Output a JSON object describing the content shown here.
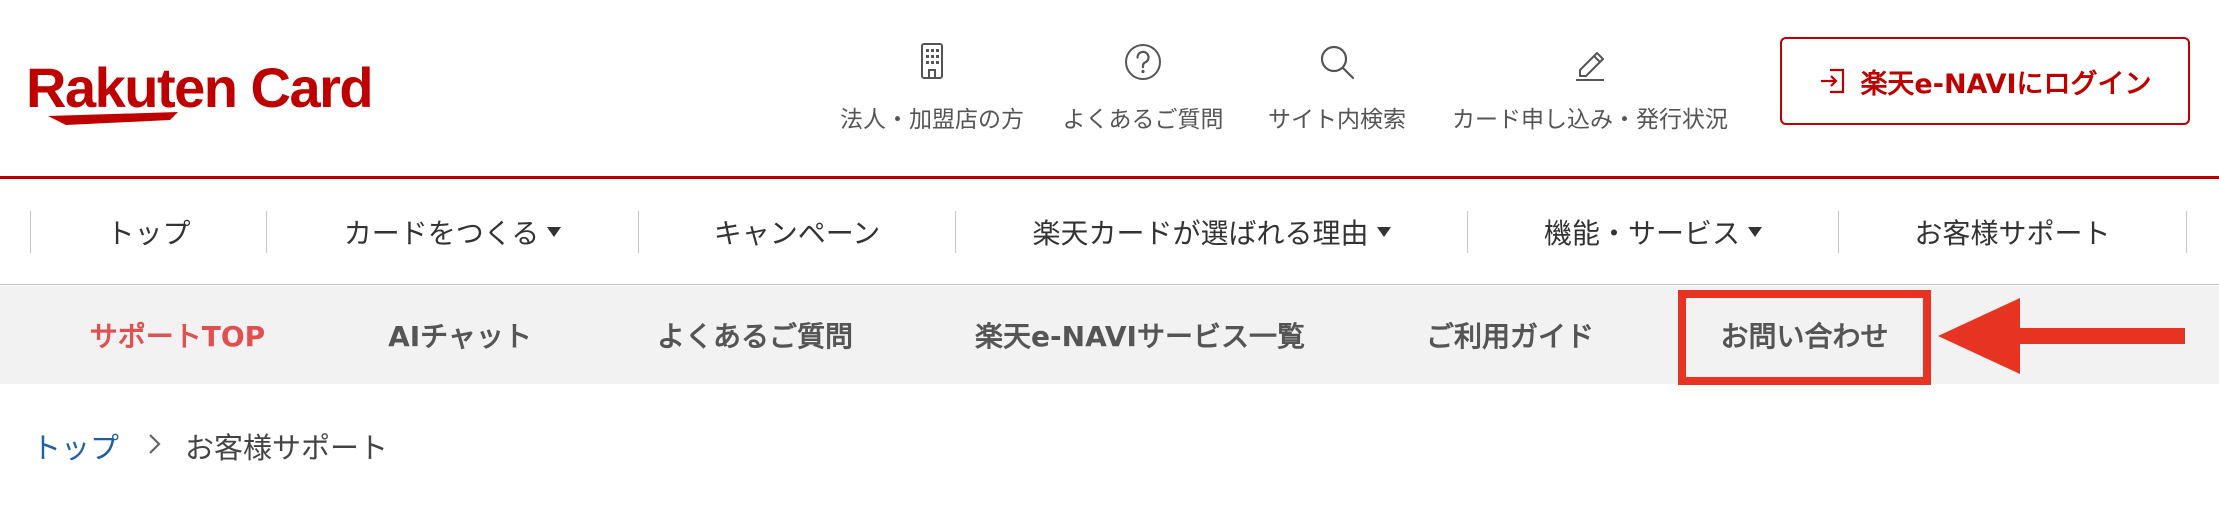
{
  "brand": {
    "logo_text": "Rakuten Card",
    "brand_color": "#bf0000"
  },
  "utility_links": [
    {
      "label": "法人・加盟店の方",
      "icon": "building-icon"
    },
    {
      "label": "よくあるご質問",
      "icon": "question-circle-icon"
    },
    {
      "label": "サイト内検索",
      "icon": "search-icon"
    },
    {
      "label": "カード申し込み・発行状況",
      "icon": "pencil-icon"
    }
  ],
  "login": {
    "label": "楽天e-NAVIにログイン",
    "icon": "login-icon"
  },
  "global_nav": [
    {
      "label": "トップ",
      "has_dropdown": false
    },
    {
      "label": "カードをつくる",
      "has_dropdown": true
    },
    {
      "label": "キャンペーン",
      "has_dropdown": false
    },
    {
      "label": "楽天カードが選ばれる理由",
      "has_dropdown": true
    },
    {
      "label": "機能・サービス",
      "has_dropdown": true
    },
    {
      "label": "お客様サポート",
      "has_dropdown": false
    }
  ],
  "sub_nav": {
    "items": [
      {
        "label": "サポートTOP",
        "active": true
      },
      {
        "label": "AIチャット",
        "active": false
      },
      {
        "label": "よくあるご質問",
        "active": false
      },
      {
        "label": "楽天e-NAVIサービス一覧",
        "active": false
      },
      {
        "label": "ご利用ガイド",
        "active": false
      },
      {
        "label": "お問い合わせ",
        "active": false
      }
    ],
    "active_color": "#e05050",
    "highlighted_item": "お問い合わせ",
    "annotation_color": "#e63322"
  },
  "breadcrumb": {
    "items": [
      "トップ",
      "お客様サポート"
    ],
    "separator": "＞"
  }
}
